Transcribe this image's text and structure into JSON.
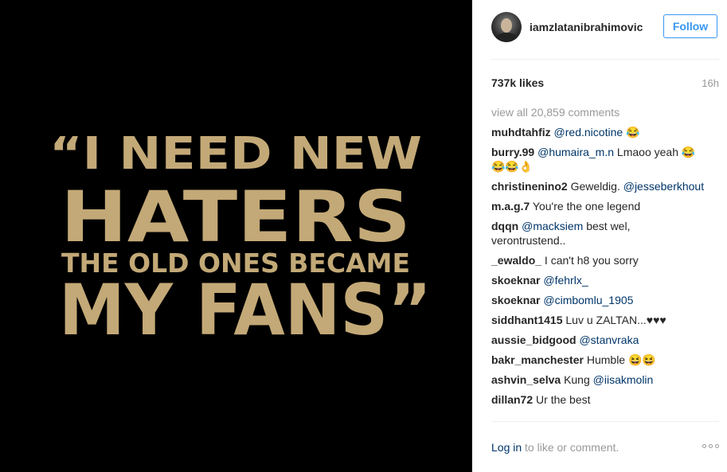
{
  "post": {
    "quote_lines": [
      "“I NEED NEW",
      "HATERS",
      "THE OLD ONES BECAME",
      "MY FANS”"
    ],
    "colors": {
      "background": "#000000",
      "text": "#c3a977"
    }
  },
  "header": {
    "username": "iamzlatanibrahimovic",
    "follow_label": "Follow"
  },
  "stats": {
    "likes": "737k likes",
    "time": "16h"
  },
  "comments": {
    "view_all": "view all 20,859 comments",
    "items": [
      {
        "user": "muhdtahfiz",
        "mention": "@red.nicotine",
        "text": " 😂"
      },
      {
        "user": "burry.99",
        "mention": "@humaira_m.n",
        "text": " Lmaoo yeah 😂😂😂👌"
      },
      {
        "user": "christinenino2",
        "text": " Geweldig. ",
        "mention": "@jesseberkhout"
      },
      {
        "user": "m.a.g.7",
        "text": " You're the one legend"
      },
      {
        "user": "dqqn",
        "mention": "@macksiem",
        "text": " best wel, verontrustend.."
      },
      {
        "user": "_ewaldo_",
        "text": " I can't h8 you sorry"
      },
      {
        "user": "skoeknar",
        "mention": "@fehrlx_"
      },
      {
        "user": "skoeknar",
        "mention": "@cimbomlu_1905"
      },
      {
        "user": "siddhant1415",
        "text": " Luv u ZALTAN...♥♥♥"
      },
      {
        "user": "aussie_bidgood",
        "mention": "@stanvraka"
      },
      {
        "user": "bakr_manchester",
        "text": " Humble 😆😆"
      },
      {
        "user": "ashvin_selva",
        "text": " Kung ",
        "mention": "@iisakmolin"
      },
      {
        "user": "dillan72",
        "text": " Ur the best"
      }
    ]
  },
  "footer": {
    "login_link": "Log in",
    "login_suffix": " to like or comment."
  }
}
